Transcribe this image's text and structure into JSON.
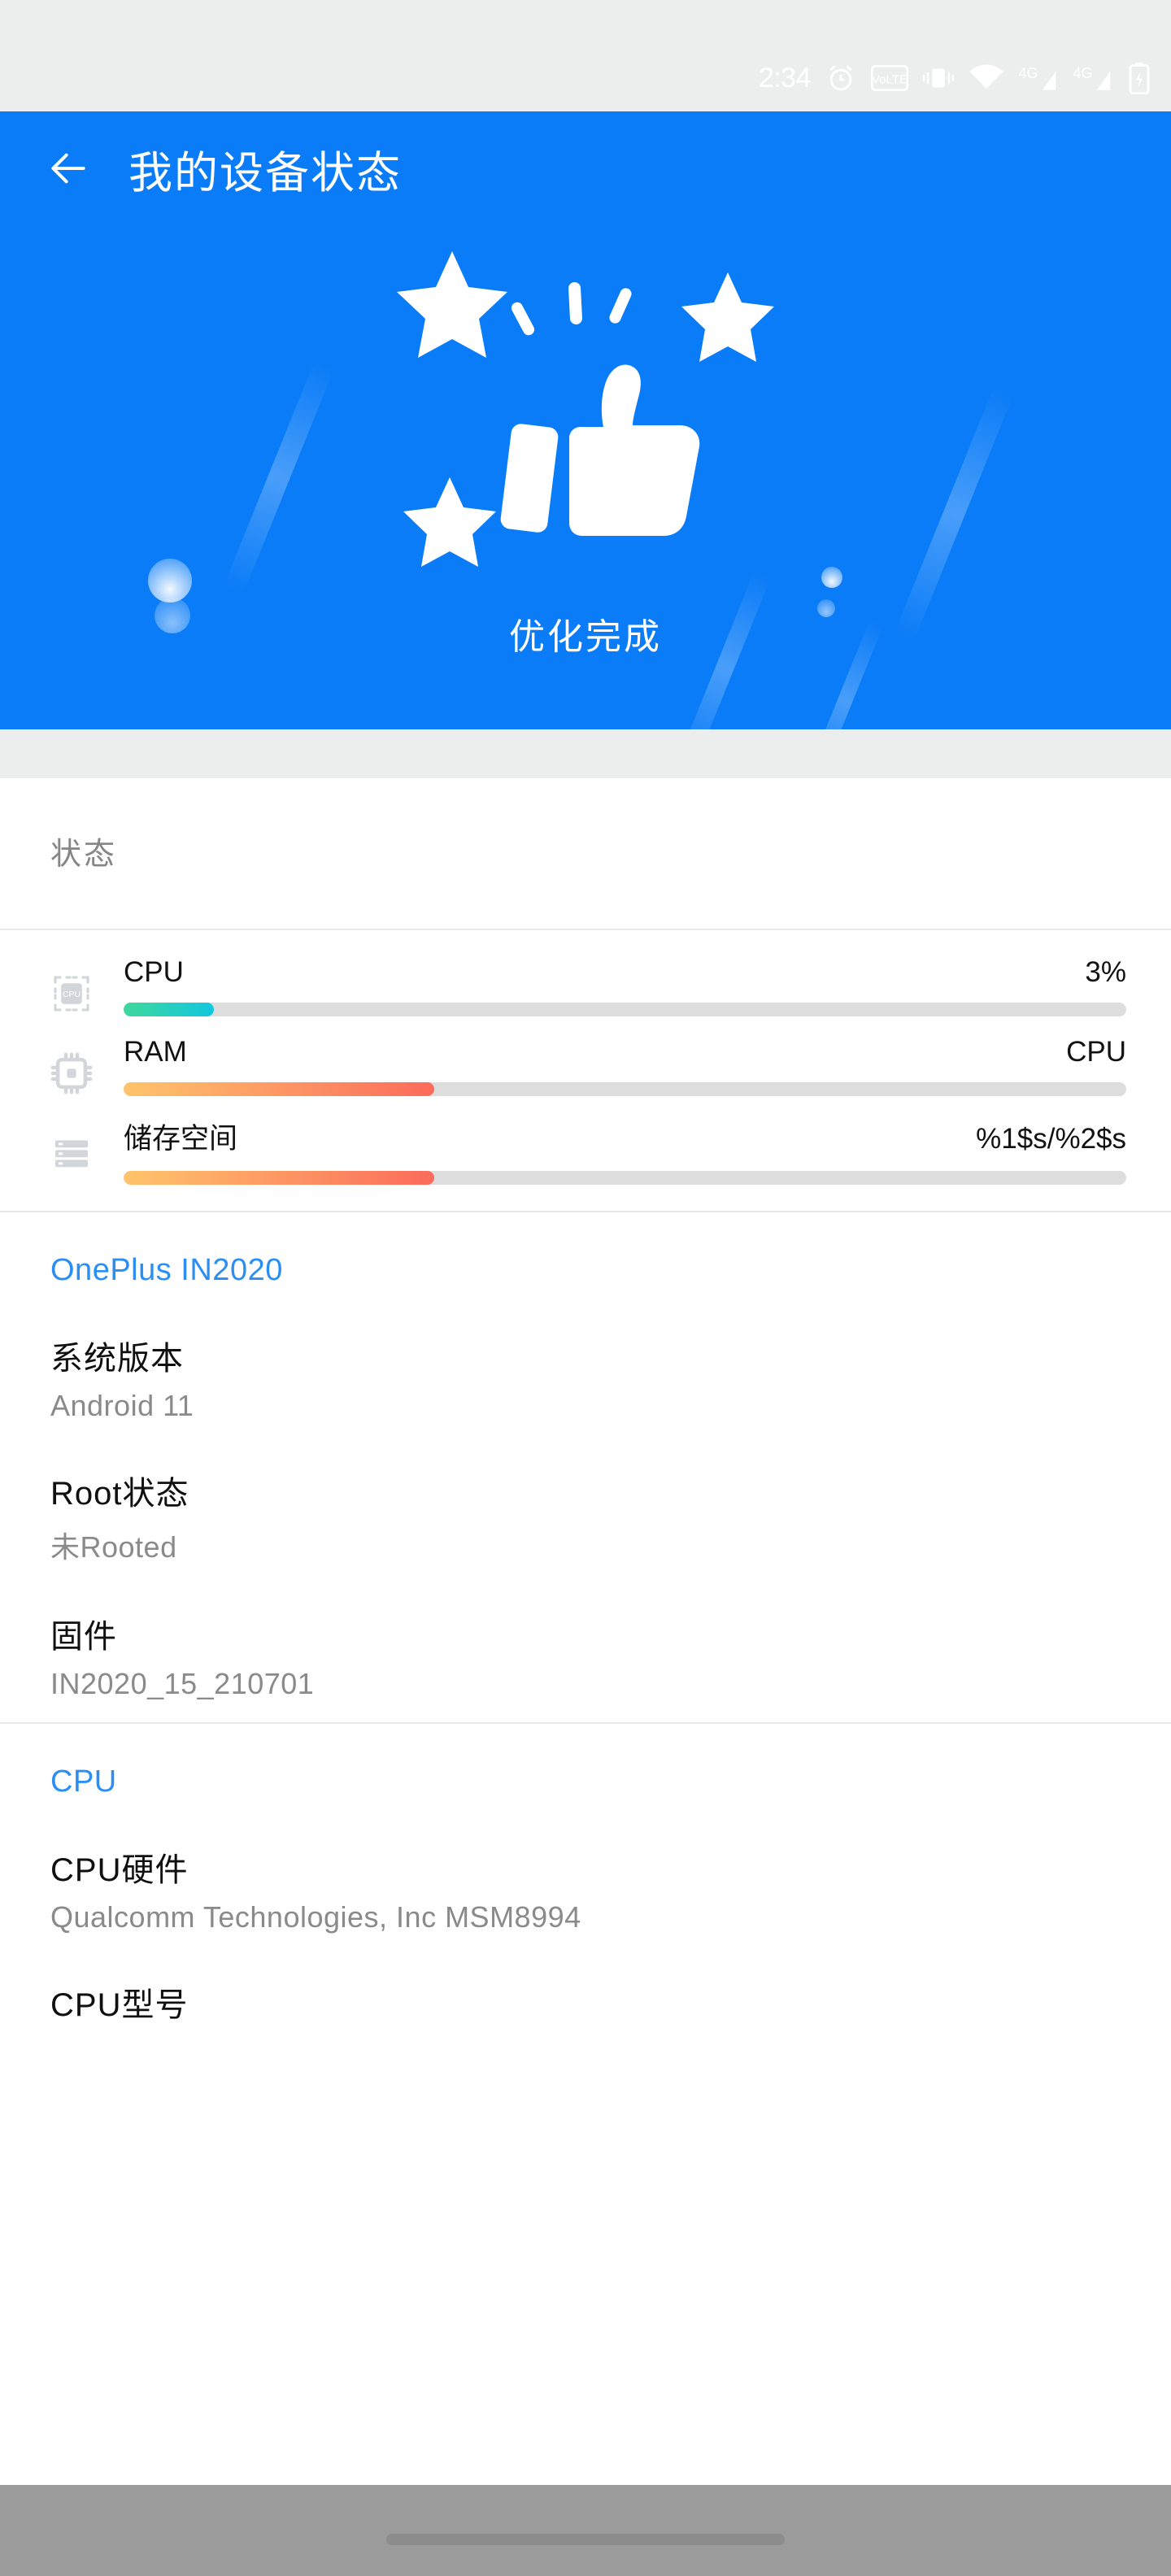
{
  "status_bar": {
    "time": "2:34",
    "icons": [
      {
        "name": "alarm-clock-icon"
      },
      {
        "name": "volte-icon",
        "label": "VoLTE"
      },
      {
        "name": "vibrate-icon"
      },
      {
        "name": "wifi-icon"
      },
      {
        "name": "signal-4g-sim1-icon",
        "label": "4G"
      },
      {
        "name": "signal-4g-sim2-icon",
        "label": "4G"
      },
      {
        "name": "battery-charging-icon"
      }
    ]
  },
  "header": {
    "back_label": "←",
    "title": "我的设备状态",
    "caption": "优化完成",
    "accent": "#0a7cf7"
  },
  "status_section": {
    "label": "状态",
    "meters": [
      {
        "icon": "cpu-chip-icon",
        "name": "CPU",
        "value": "3%",
        "percent": 9,
        "tone": "cool"
      },
      {
        "icon": "ram-chip-icon",
        "name": "RAM",
        "value": "CPU",
        "percent": 31,
        "tone": "warm"
      },
      {
        "icon": "storage-icon",
        "name": "储存空间",
        "value": "%1$s/%2$s",
        "percent": 31,
        "tone": "warm"
      }
    ]
  },
  "device_section": {
    "header": "OnePlus IN2020",
    "items": [
      {
        "title": "系统版本",
        "sub": "Android 11"
      },
      {
        "title": "Root状态",
        "sub": "未Rooted"
      },
      {
        "title": "固件",
        "sub": "IN2020_15_210701"
      }
    ]
  },
  "cpu_section": {
    "header": "CPU",
    "items": [
      {
        "title": "CPU硬件",
        "sub": "Qualcomm Technologies, Inc MSM8994"
      },
      {
        "title": "CPU型号",
        "sub": ""
      }
    ]
  },
  "colors": {
    "accent_blue": "#0a7cf7",
    "link_blue": "#2b8ef3",
    "status_bar_bg": "#eceeed",
    "track": "#dddddd"
  }
}
